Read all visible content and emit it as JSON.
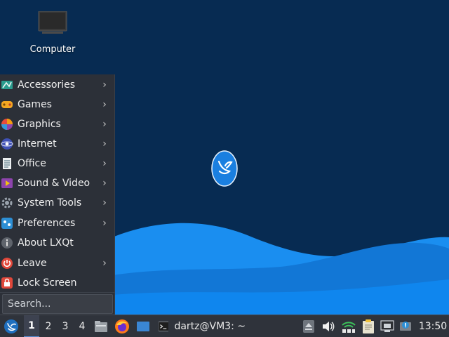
{
  "desktop": {
    "icons": [
      {
        "label": "Computer",
        "icon": "computer-icon"
      }
    ]
  },
  "menu": {
    "items": [
      {
        "label": "Accessories",
        "icon": "accessories-icon",
        "submenu": true
      },
      {
        "label": "Games",
        "icon": "games-icon",
        "submenu": true
      },
      {
        "label": "Graphics",
        "icon": "graphics-icon",
        "submenu": true
      },
      {
        "label": "Internet",
        "icon": "internet-icon",
        "submenu": true
      },
      {
        "label": "Office",
        "icon": "office-icon",
        "submenu": true
      },
      {
        "label": "Sound & Video",
        "icon": "sound-video-icon",
        "submenu": true
      },
      {
        "label": "System Tools",
        "icon": "system-tools-icon",
        "submenu": true
      },
      {
        "label": "Preferences",
        "icon": "preferences-icon",
        "submenu": true
      },
      {
        "label": "About LXQt",
        "icon": "info-icon",
        "submenu": false
      },
      {
        "label": "Leave",
        "icon": "power-icon",
        "submenu": true
      },
      {
        "label": "Lock Screen",
        "icon": "lock-icon",
        "submenu": false
      }
    ],
    "submenu_arrow": "›",
    "search_placeholder": "Search..."
  },
  "taskbar": {
    "desktops": [
      "1",
      "2",
      "3",
      "4"
    ],
    "active_desktop": "1",
    "launchers": [
      "file-manager-icon",
      "firefox-icon",
      "show-desktop-icon"
    ],
    "task": {
      "label": "dartz@VM3: ~",
      "icon": "terminal-icon"
    },
    "tray": [
      "eject-icon",
      "volume-icon",
      "network-icon",
      "clipboard-icon",
      "ethernet-icon",
      "update-notifier-icon"
    ],
    "clock": "13:50"
  },
  "colors": {
    "desktop_bg": "#072b52",
    "wave_light": "#1a8ef0",
    "wave_mid": "#1177d8",
    "menu_bg": "#2c3038",
    "taskbar_bg": "#2f333b"
  }
}
